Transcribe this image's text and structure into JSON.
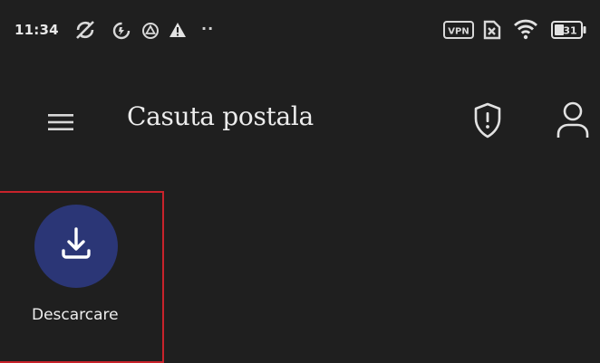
{
  "status_bar": {
    "time": "11:34",
    "overflow_indicator": "··",
    "icons": [
      "sync-off-icon",
      "data-saver-icon",
      "drive-icon",
      "warning-icon",
      "vpn-icon",
      "no-sim-icon",
      "wifi-icon",
      "battery-icon"
    ],
    "vpn_label": "VPN",
    "battery_level": "31"
  },
  "app_bar": {
    "title": "Casuta postala",
    "menu_icon": "menu-icon",
    "security_icon": "shield-alert-icon",
    "account_icon": "account-icon"
  },
  "tiles": [
    {
      "label": "Descarcare",
      "icon": "download-icon",
      "selected": true
    }
  ],
  "colors": {
    "background": "#1f1f1f",
    "tile_circle": "#2b3676",
    "selection_outline": "#c8232b",
    "text": "#ececec"
  }
}
